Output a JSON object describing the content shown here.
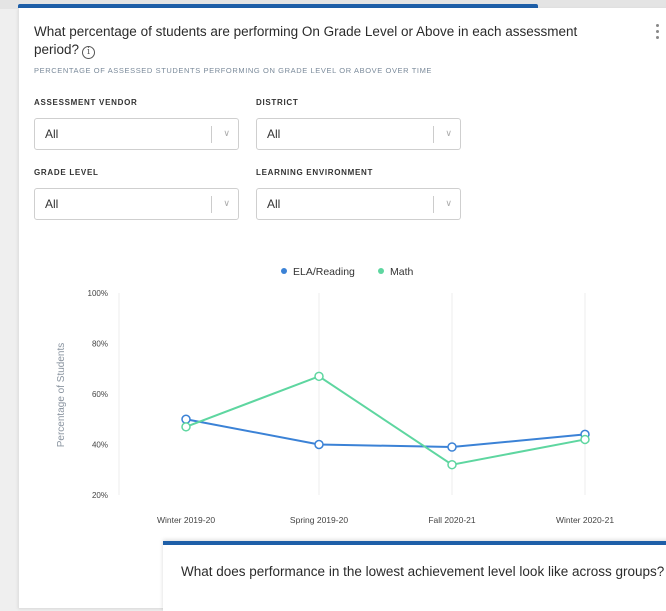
{
  "card": {
    "title": "What percentage of students are performing On Grade Level or Above in each assessment period?",
    "subtitle": "PERCENTAGE OF ASSESSED STUDENTS PERFORMING ON GRADE LEVEL OR ABOVE OVER TIME",
    "info_icon": "i"
  },
  "filters": {
    "vendor": {
      "label": "ASSESSMENT VENDOR",
      "value": "All"
    },
    "district": {
      "label": "DISTRICT",
      "value": "All"
    },
    "grade": {
      "label": "GRADE LEVEL",
      "value": "All"
    },
    "environment": {
      "label": "LEARNING ENVIRONMENT",
      "value": "All"
    },
    "chevron": "∨"
  },
  "chart_data": {
    "type": "line",
    "categories": [
      "Winter 2019-20",
      "Spring 2019-20",
      "Fall 2020-21",
      "Winter 2020-21"
    ],
    "series": [
      {
        "name": "ELA/Reading",
        "color": "#3b82d6",
        "values": [
          50,
          40,
          39,
          44
        ]
      },
      {
        "name": "Math",
        "color": "#5ed6a0",
        "values": [
          47,
          67,
          32,
          42
        ]
      }
    ],
    "ylabel": "Percentage of Students",
    "yticks": [
      "100%",
      "80%",
      "60%",
      "40%",
      "20%"
    ],
    "ylim": [
      20,
      100
    ],
    "grid": "vertical",
    "legend": "top-center"
  },
  "second_card": {
    "title": "What does performance in the lowest achievement level look like across groups?",
    "info_icon": "i"
  }
}
